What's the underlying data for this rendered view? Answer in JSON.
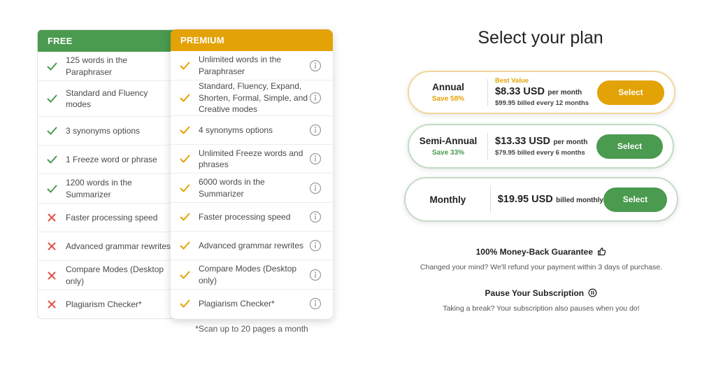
{
  "free": {
    "header": "FREE",
    "features": [
      {
        "text": "125 words in the Paraphraser",
        "included": true
      },
      {
        "text": "Standard and Fluency modes",
        "included": true
      },
      {
        "text": "3 synonyms options",
        "included": true
      },
      {
        "text": "1 Freeze word or phrase",
        "included": true
      },
      {
        "text": "1200 words in the Summarizer",
        "included": true
      },
      {
        "text": "Faster processing speed",
        "included": false
      },
      {
        "text": "Advanced grammar rewrites",
        "included": false
      },
      {
        "text": "Compare Modes (Desktop only)",
        "included": false
      },
      {
        "text": "Plagiarism Checker*",
        "included": false
      }
    ]
  },
  "premium": {
    "header": "PREMIUM",
    "features": [
      {
        "text": "Unlimited words in the Paraphraser"
      },
      {
        "text": "Standard, Fluency, Expand, Shorten, Formal, Simple, and Creative modes"
      },
      {
        "text": "4 synonyms options"
      },
      {
        "text": "Unlimited Freeze words and phrases"
      },
      {
        "text": "6000 words in the Summarizer"
      },
      {
        "text": "Faster processing speed"
      },
      {
        "text": "Advanced grammar rewrites"
      },
      {
        "text": "Compare Modes (Desktop only)"
      },
      {
        "text": "Plagiarism Checker*"
      }
    ]
  },
  "footnote": "*Scan up to 20 pages a month",
  "plans": {
    "title": "Select your plan",
    "annual": {
      "name": "Annual",
      "save": "Save 58%",
      "badge": "Best Value",
      "price": "$8.33 USD",
      "unit": "per month",
      "billing": "$99.95 billed every 12 months",
      "button": "Select"
    },
    "semi_annual": {
      "name": "Semi-Annual",
      "save": "Save 33%",
      "price": "$13.33 USD",
      "unit": "per month",
      "billing": "$79.95 billed every 6 months",
      "button": "Select"
    },
    "monthly": {
      "name": "Monthly",
      "price": "$19.95 USD",
      "unit": "billed monthly",
      "button": "Select"
    }
  },
  "guarantee": {
    "title": "100% Money-Back Guarantee",
    "text": "Changed your mind? We'll refund your payment within 3 days of purchase."
  },
  "pause": {
    "title": "Pause Your Subscription",
    "text": "Taking a break? Your subscription also pauses when you do!"
  },
  "colors": {
    "free_green": "#4a9a4f",
    "premium_gold": "#e3a205",
    "cross_red": "#e0534a"
  },
  "icons": {
    "included": "check-icon",
    "excluded": "cross-icon",
    "info": "info-icon",
    "guarantee": "thumbs-up-icon",
    "pause": "pause-icon"
  }
}
